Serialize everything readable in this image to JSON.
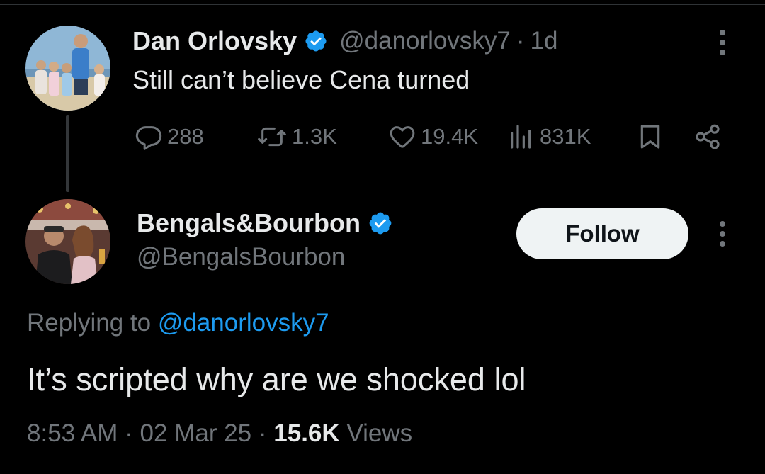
{
  "colors": {
    "background": "#000000",
    "primary_text": "#e7e9ea",
    "secondary_text": "#71767b",
    "accent": "#1d9bf0",
    "follow_button_bg": "#eff3f4",
    "follow_button_text": "#0f1419"
  },
  "parent_tweet": {
    "author": {
      "display_name": "Dan Orlovsky",
      "handle": "@danorlovsky7",
      "verified_icon": "verified-badge-icon",
      "avatar": "avatar-photo"
    },
    "separator": "·",
    "time_ago": "1d",
    "text": "Still can’t believe Cena turned",
    "more_icon": "more-options-icon",
    "actions": {
      "reply": {
        "icon": "reply-icon",
        "count": "288"
      },
      "retweet": {
        "icon": "retweet-icon",
        "count": "1.3K"
      },
      "like": {
        "icon": "like-heart-icon",
        "count": "19.4K"
      },
      "views": {
        "icon": "analytics-icon",
        "count": "831K"
      },
      "bookmark": {
        "icon": "bookmark-icon"
      },
      "share": {
        "icon": "share-icon"
      }
    }
  },
  "reply_tweet": {
    "author": {
      "display_name": "Bengals&Bourbon",
      "handle": "@BengalsBourbon",
      "verified_icon": "verified-badge-icon",
      "avatar": "avatar-photo"
    },
    "follow_label": "Follow",
    "more_icon": "more-options-icon",
    "replying_prefix": "Replying to",
    "replying_mention": "@danorlovsky7",
    "text": "It’s scripted why are we shocked lol",
    "meta": {
      "time": "8:53 AM",
      "separator": "·",
      "date": "02 Mar 25",
      "views_count": "15.6K",
      "views_label": "Views"
    }
  }
}
